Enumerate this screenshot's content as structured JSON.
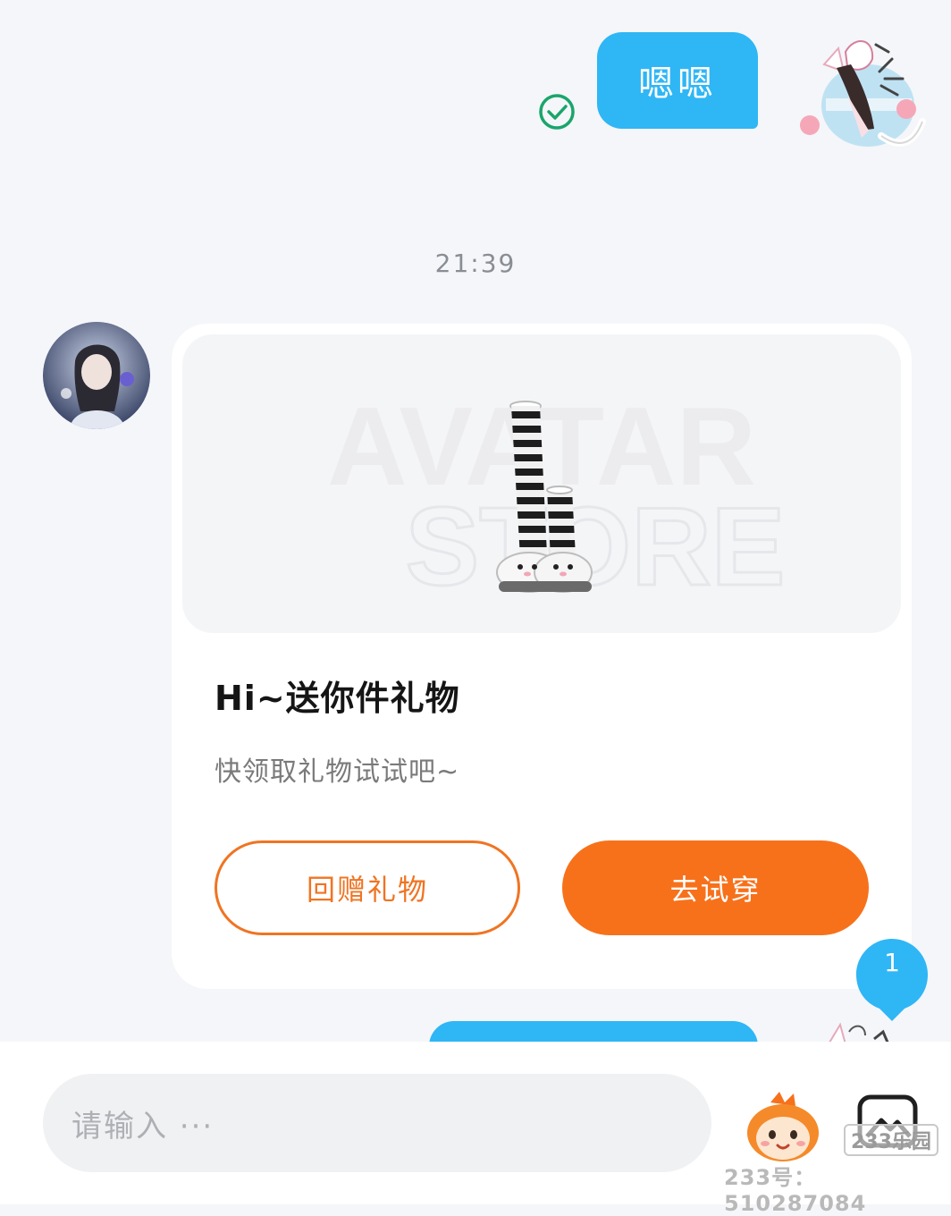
{
  "conversation": {
    "outgoing_message": "嗯嗯",
    "timestamp": "21:39"
  },
  "gift_card": {
    "watermark_line1": "AVATAR",
    "watermark_line2": "STORE",
    "title": "Hi~送你件礼物",
    "subtitle": "快领取礼物试试吧~",
    "return_gift_label": "回赠礼物",
    "try_on_label": "去试穿"
  },
  "unread_badge": {
    "count": "1",
    "color": "#2fb6f5"
  },
  "input_bar": {
    "placeholder": "请输入 ···",
    "brand_tag": "233乐园",
    "user_id": "233号：510287084"
  },
  "colors": {
    "accent_blue": "#2fb6f5",
    "accent_orange": "#f7711b",
    "check_green": "#1aa56b",
    "background": "#f4f6f9"
  },
  "icons": [
    "check-circle-icon",
    "mascot-icon",
    "image-picker-icon"
  ]
}
